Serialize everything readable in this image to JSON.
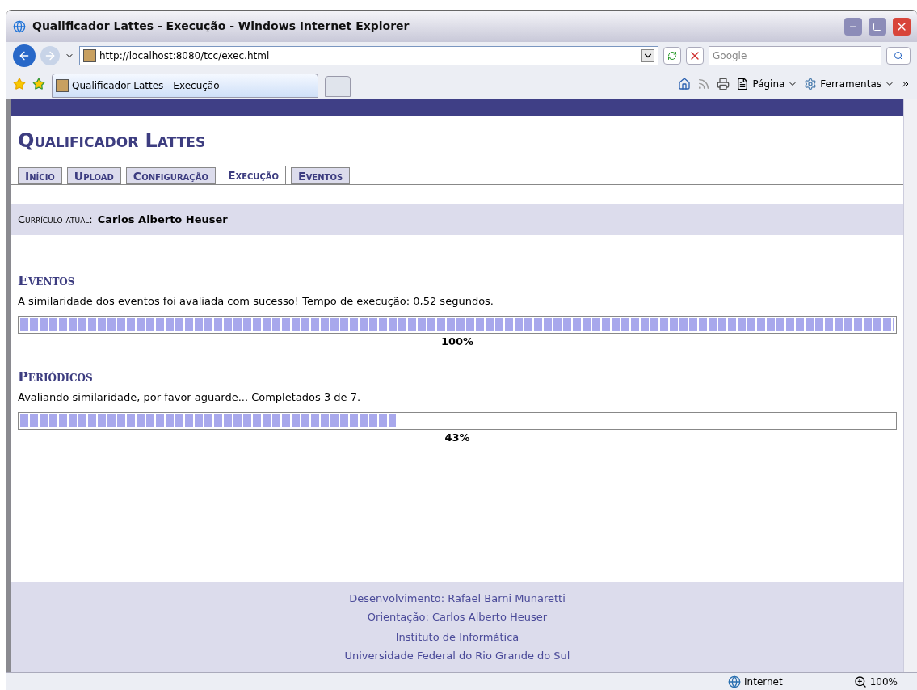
{
  "window": {
    "title": "Qualificador Lattes - Execução - Windows Internet Explorer"
  },
  "address_bar": {
    "url": "http://localhost:8080/tcc/exec.html"
  },
  "search": {
    "placeholder": "Google"
  },
  "browser_tabs": [
    {
      "label": "Qualificador Lattes - Execução",
      "selected": true
    }
  ],
  "command_bar": [
    "Página",
    "Ferramentas"
  ],
  "page": {
    "title": "Qualificador Lattes",
    "tabs": [
      {
        "label": "Início",
        "selected": false
      },
      {
        "label": "Upload",
        "selected": false
      },
      {
        "label": "Configuração",
        "selected": false
      },
      {
        "label": "Execução",
        "selected": true
      },
      {
        "label": "Eventos",
        "selected": false
      }
    ],
    "current": {
      "label": "Currículo atual:",
      "name": "Carlos Alberto Heuser"
    },
    "sections": [
      {
        "title": "Eventos",
        "message": "A similaridade dos eventos foi avaliada com sucesso! Tempo de execução: 0,52 segundos.",
        "level": 1,
        "reading": "100%"
      },
      {
        "title": "Periódicos",
        "message": "Avaliando similaridade, por favor aguarde... Completados 3 de 7.",
        "level": 0.43,
        "reading": "43%"
      }
    ],
    "footer": [
      [
        "Desenvolvimento: Rafael Barni Munaretti",
        "Orientação: Carlos Alberto Heuser"
      ],
      [
        "Instituto de Informática",
        "Universidade Federal do Rio Grande do Sul"
      ]
    ]
  },
  "status_bar": {
    "zone": "Internet",
    "zoom": "100%"
  }
}
